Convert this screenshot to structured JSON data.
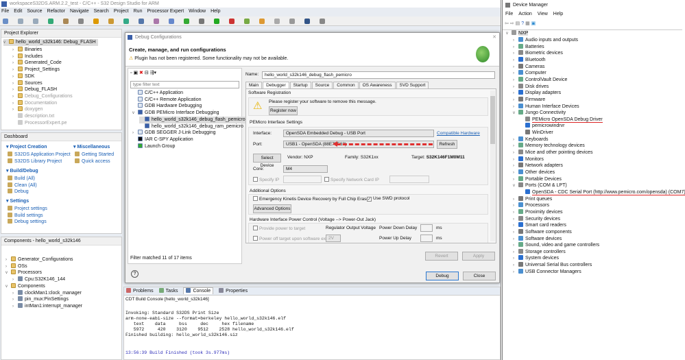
{
  "eclipse": {
    "title": "workspaceS32DS.ARM.2.2_test - C/C++ - S32 Design Studio for ARM",
    "menu": [
      "File",
      "Edit",
      "Source",
      "Refactor",
      "Navigate",
      "Search",
      "Project",
      "Run",
      "Processor Expert",
      "Window",
      "Help"
    ],
    "project_explorer": {
      "title": "Project Explorer",
      "root": "hello_world_s32k146: Debug_FLASH",
      "items": [
        "Binaries",
        "Includes",
        "Generated_Code",
        "Project_Settings",
        "SDK",
        "Sources",
        "Debug_FLASH",
        "Debug_Configurations",
        "Documentation",
        "doxygen",
        "description.txt",
        "ProcessorExpert.pe"
      ]
    },
    "dashboard": {
      "title": "Dashboard",
      "project_creation": {
        "title": "Project Creation",
        "items": [
          "S32DS Application Project",
          "S32DS Library Project"
        ]
      },
      "miscellaneous": {
        "title": "Miscellaneous",
        "items": [
          "Getting Started",
          "Quick access"
        ]
      },
      "build_debug": {
        "title": "Build/Debug",
        "items": [
          "Build   (All)",
          "Clean   (All)",
          "Debug"
        ]
      },
      "settings": {
        "title": "Settings",
        "items": [
          "Project settings",
          "Build settings",
          "Debug settings"
        ]
      }
    },
    "components": {
      "title": "Components - hello_world_s32k146",
      "items": [
        "Generator_Configurations",
        "OSs",
        "Processors",
        "Cpu:S32K146_144",
        "Components",
        "clockMan1:clock_manager",
        "pin_mux:PinSettings",
        "intMan1:interrupt_manager"
      ]
    },
    "console": {
      "tabs": [
        "Problems",
        "Tasks",
        "Console",
        "Properties"
      ],
      "header": "CDT Build Console [hello_world_s32k146]",
      "lines": [
        "Invoking: Standard S32DS Print Size",
        "arm-none-eabi-size --format=berkeley hello_world_s32k146.elf",
        "   text    data     bss     dec     hex filename",
        "   5972     420    3120    9512    2528 hello_world_s32k146.elf",
        "Finished building: hello_world_s32k146.siz"
      ],
      "finished": "13:56:39 Build Finished (took 3s.977ms)"
    }
  },
  "dialog": {
    "title": "Debug Configurations",
    "heading": "Create, manage, and run configurations",
    "warning": "Plugin has not been registered. Some functionality may not be available.",
    "filter_placeholder": "type filter text",
    "tree": [
      "C/C++ Application",
      "C/C++ Remote Application",
      "GDB Hardware Debugging",
      "GDB PEMicro Interface Debugging",
      "hello_world_s32k146_debug_flash_pemicro",
      "hello_world_s32k146_debug_ram_pemicro",
      "GDB SEGGER J-Link Debugging",
      "IAR C-SPY Application",
      "Launch Group"
    ],
    "filter_status": "Filter matched 11 of 17 items",
    "name_label": "Name:",
    "name_value": "hello_world_s32k146_debug_flash_pemicro",
    "tabs": [
      "Main",
      "Debugger",
      "Startup",
      "Source",
      "Common",
      "OS Awareness",
      "SVD Support"
    ],
    "registration": {
      "title": "Software Registration",
      "message": "Please register your software to remove this message.",
      "button": "Register now"
    },
    "pemicro": {
      "title": "PEMicro Interface Settings",
      "interface_label": "Interface:",
      "interface_value": "OpenSDA Embedded Debug - USB Port",
      "compatible": "Compatible Hardware",
      "port_label": "Port:",
      "port_value": "USB1 - OpenSDA (88E75E62)",
      "refresh": "Refresh",
      "select_device": "Select Device",
      "vendor": "Vendor: NXP",
      "family": "Family: S32K1xx",
      "target_label": "Target:",
      "target_value": "S32K146F1M0M11",
      "core_label": "Core:",
      "core_value": "M4",
      "specify_ip": "Specify IP",
      "specify_nic": "Specify Network Card IP"
    },
    "additional": {
      "title": "Additional Options",
      "emergency": "Emergency Kinetis Device Recovery by Full Chip Erase",
      "swd": "Use SWD protocol",
      "advanced": "Advanced Options"
    },
    "power": {
      "title": "Hardware Interface Power Control (Voltage --> Power-Out Jack)",
      "provide": "Provide power to target",
      "power_off": "Power off target upon software exit",
      "regulator": "Regulator Output Voltage",
      "voltage": "2V",
      "down": "Power Down Delay",
      "up": "Power Up Delay",
      "ms": "ms"
    },
    "revert": "Revert",
    "apply": "Apply",
    "debug": "Debug",
    "close": "Close",
    "help": "?"
  },
  "device_manager": {
    "title": "Device Manager",
    "menu": [
      "File",
      "Action",
      "View",
      "Help"
    ],
    "root": "NXP",
    "items": [
      {
        "label": "Audio inputs and outputs",
        "level": 1
      },
      {
        "label": "Batteries",
        "level": 1
      },
      {
        "label": "Biometric devices",
        "level": 1
      },
      {
        "label": "Bluetooth",
        "level": 1
      },
      {
        "label": "Cameras",
        "level": 1
      },
      {
        "label": "Computer",
        "level": 1
      },
      {
        "label": "ControlVault Device",
        "level": 1
      },
      {
        "label": "Disk drives",
        "level": 1
      },
      {
        "label": "Display adapters",
        "level": 1
      },
      {
        "label": "Firmware",
        "level": 1
      },
      {
        "label": "Human Interface Devices",
        "level": 1
      },
      {
        "label": "Jungo Connectivity",
        "level": 1,
        "open": true
      },
      {
        "label": "PEMicro OpenSDA Debug Driver",
        "level": 2,
        "highlight": true
      },
      {
        "label": "pemicrowindrvr",
        "level": 2
      },
      {
        "label": "WinDriver",
        "level": 2
      },
      {
        "label": "Keyboards",
        "level": 1
      },
      {
        "label": "Memory technology devices",
        "level": 1
      },
      {
        "label": "Mice and other pointing devices",
        "level": 1
      },
      {
        "label": "Monitors",
        "level": 1
      },
      {
        "label": "Network adapters",
        "level": 1
      },
      {
        "label": "Other devices",
        "level": 1
      },
      {
        "label": "Portable Devices",
        "level": 1
      },
      {
        "label": "Ports (COM & LPT)",
        "level": 1,
        "open": true
      },
      {
        "label": "OpenSDA - CDC Serial Port (http://www.pemicro.com/opensda) (COM7)",
        "level": 2,
        "highlight": true
      },
      {
        "label": "Print queues",
        "level": 1
      },
      {
        "label": "Processors",
        "level": 1
      },
      {
        "label": "Proximity devices",
        "level": 1
      },
      {
        "label": "Security devices",
        "level": 1
      },
      {
        "label": "Smart card readers",
        "level": 1
      },
      {
        "label": "Software components",
        "level": 1
      },
      {
        "label": "Software devices",
        "level": 1
      },
      {
        "label": "Sound, video and game controllers",
        "level": 1
      },
      {
        "label": "Storage controllers",
        "level": 1
      },
      {
        "label": "System devices",
        "level": 1
      },
      {
        "label": "Universal Serial Bus controllers",
        "level": 1
      },
      {
        "label": "USB Connector Managers",
        "level": 1
      }
    ]
  },
  "colors": {
    "highlight_underline": "#d22",
    "arrow": "#e03030",
    "link": "#1a5fb4",
    "dash_heading": "#1a5fb4"
  }
}
